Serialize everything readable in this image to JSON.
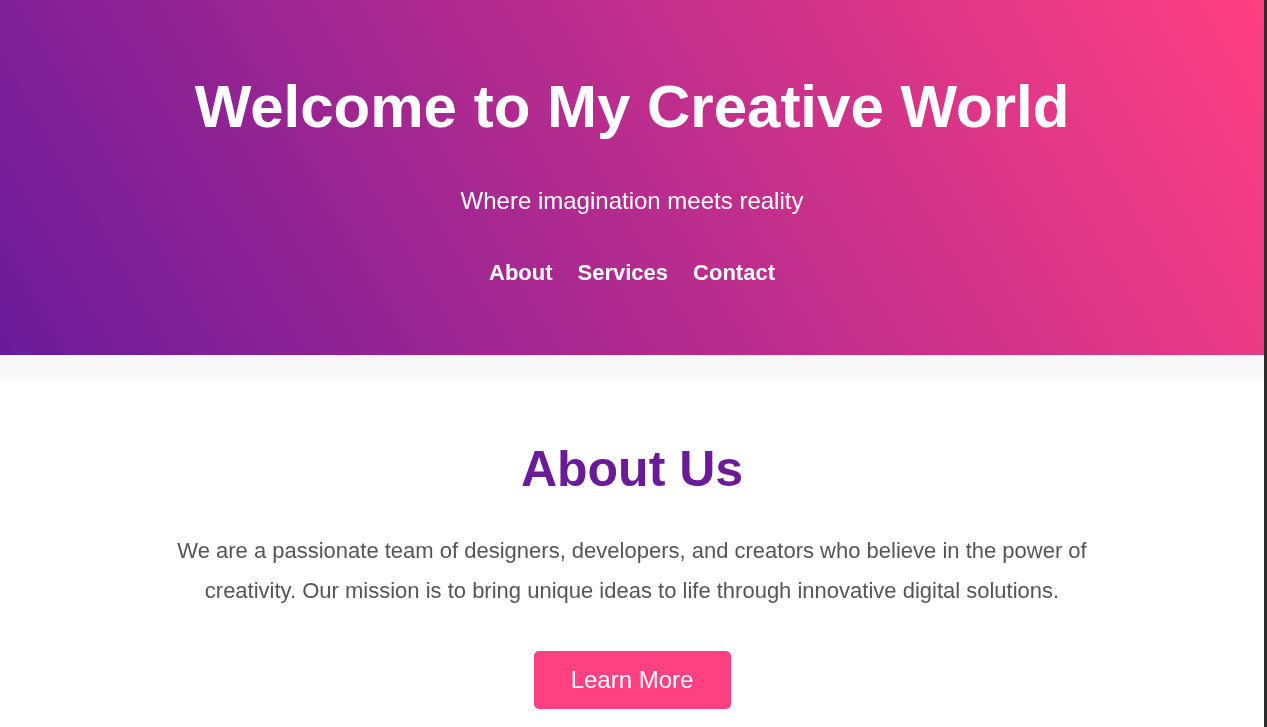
{
  "header": {
    "title": "Welcome to My Creative World",
    "subtitle": "Where imagination meets reality",
    "nav": [
      "About",
      "Services",
      "Contact"
    ]
  },
  "about": {
    "heading": "About Us",
    "text": "We are a passionate team of designers, developers, and creators who believe in the power of creativity. Our mission is to bring unique ideas to life through innovative digital solutions.",
    "button": "Learn More"
  }
}
